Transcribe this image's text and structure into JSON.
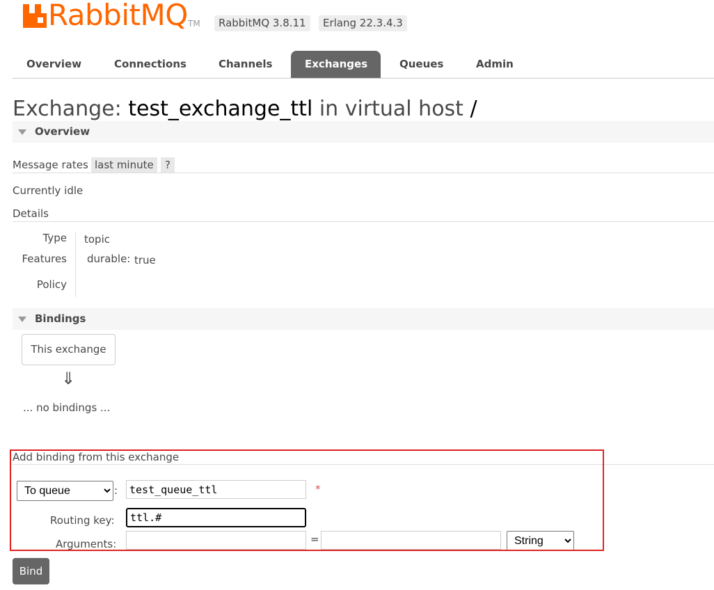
{
  "header": {
    "brand": "RabbitMQ",
    "tm": "TM",
    "rabbitmq_version": "RabbitMQ 3.8.11",
    "erlang_version": "Erlang 22.3.4.3",
    "brand_color": "#ff6600"
  },
  "tabs": [
    {
      "label": "Overview"
    },
    {
      "label": "Connections"
    },
    {
      "label": "Channels"
    },
    {
      "label": "Exchanges"
    },
    {
      "label": "Queues"
    },
    {
      "label": "Admin"
    }
  ],
  "page": {
    "title_prefix": "Exchange:",
    "exchange_name": "test_exchange_ttl",
    "title_mid": "in virtual host",
    "vhost": "/"
  },
  "overview": {
    "section_title": "Overview",
    "message_rates_label": "Message rates",
    "rates_period": "last minute",
    "help": "?",
    "status": "Currently idle",
    "details_label": "Details",
    "type_key": "Type",
    "type_value": "topic",
    "features_key": "Features",
    "durable_key": "durable:",
    "durable_value": "true",
    "policy_key": "Policy"
  },
  "bindings": {
    "section_title": "Bindings",
    "this_exchange": "This exchange",
    "arrow": "⇓",
    "no_bindings": "... no bindings ..."
  },
  "add_binding": {
    "title": "Add binding from this exchange",
    "destination_type": "To queue",
    "colon": ":",
    "destination_value": "test_queue_ttl",
    "required_mark": "*",
    "routing_key_label": "Routing key:",
    "routing_key_value": "ttl.#",
    "arguments_label": "Arguments:",
    "arg_key": "",
    "equals": "=",
    "arg_value": "",
    "arg_type": "String",
    "bind_label": "Bind",
    "highlight_color": "#e02020"
  }
}
